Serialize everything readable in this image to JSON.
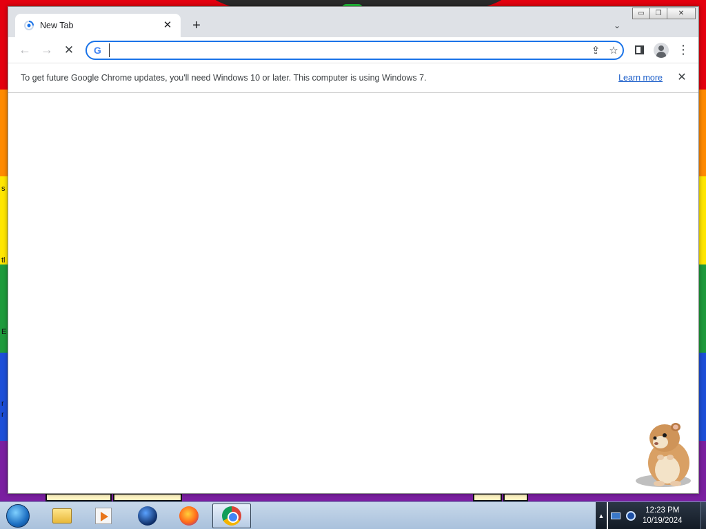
{
  "browser": {
    "tab": {
      "title": "New Tab"
    },
    "omnibox": {
      "value": "",
      "placeholder": ""
    },
    "infobar": {
      "message": "To get future Google Chrome updates, you'll need Windows 10 or later. This computer is using Windows 7.",
      "link": "Learn more"
    },
    "icons": {
      "tab_close": "✕",
      "new_tab": "+",
      "tab_search": "⌄",
      "back": "←",
      "forward": "→",
      "stop": "✕",
      "google": "G",
      "share": "⇪",
      "star": "☆",
      "menu": "⋮",
      "info_close": "✕"
    },
    "window_controls": {
      "minimize": "▭",
      "restore": "❐",
      "close": "✕"
    }
  },
  "desktop": {
    "edge_letters": [
      "s",
      "tl",
      "E",
      "r",
      "r"
    ]
  },
  "taskbar": {
    "apps": [
      {
        "name": "Windows Explorer",
        "icon": "folder-icon"
      },
      {
        "name": "Windows Media Player",
        "icon": "media-player-icon"
      },
      {
        "name": "Globe app",
        "icon": "globe-icon"
      },
      {
        "name": "Firefox",
        "icon": "firefox-icon"
      },
      {
        "name": "Google Chrome",
        "icon": "chrome-icon",
        "active": true
      }
    ],
    "tray_arrow": "▲",
    "clock": {
      "time": "12:23 PM",
      "date": "10/19/2024"
    }
  },
  "colors": {
    "accent": "#1a73e8",
    "link": "#1a5dc9",
    "tab_strip": "#dee1e6",
    "rainbow": [
      "#e4000f",
      "#ff8a00",
      "#ffe600",
      "#1e9b3c",
      "#1d4fd8",
      "#7a1fa0"
    ]
  }
}
